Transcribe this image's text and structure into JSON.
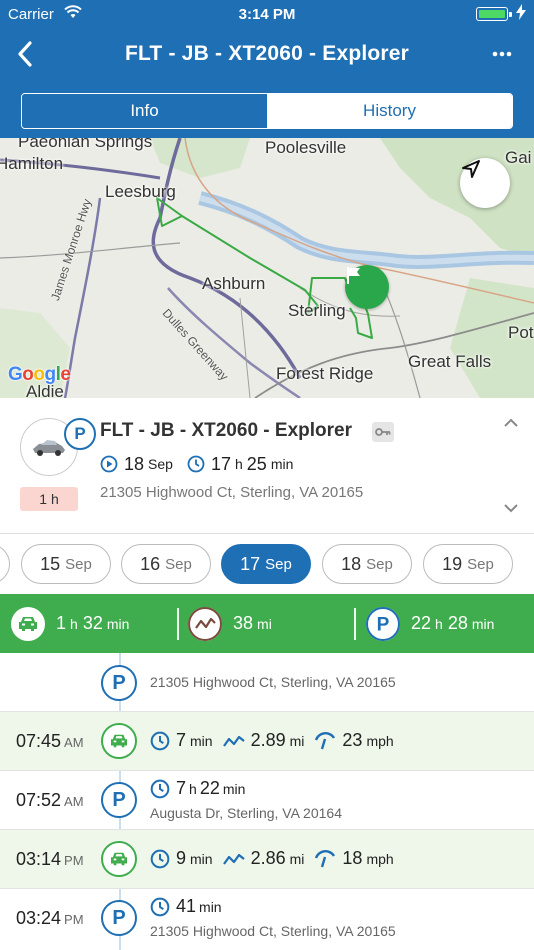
{
  "status_bar": {
    "carrier": "Carrier",
    "time": "3:14 PM"
  },
  "nav": {
    "title": "FLT - JB - XT2060 - Explorer"
  },
  "tabs": [
    {
      "label": "Info",
      "active": true
    },
    {
      "label": "History",
      "active": false
    }
  ],
  "map": {
    "places": [
      "Paeonian Springs",
      "Hamilton",
      "Poolesville",
      "Gai",
      "Leesburg",
      "Ashburn",
      "Sterling",
      "Pot",
      "Great Falls",
      "Forest Ridge",
      "Aldie"
    ],
    "roads": [
      "James Monroe Hwy",
      "Dulles Greenway"
    ],
    "attribution": "Google"
  },
  "vehicle": {
    "name": "FLT - JB - XT2060 - Explorer",
    "badge": "P",
    "duration_badge": "1 h",
    "date_day": "18",
    "date_month": "Sep",
    "drive_h": "17",
    "drive_h_unit": "h",
    "drive_m": "25",
    "drive_m_unit": "min",
    "address": "21305 Highwood Ct, Sterling, VA 20165"
  },
  "dates": [
    {
      "day": "15",
      "month": "Sep",
      "active": false
    },
    {
      "day": "16",
      "month": "Sep",
      "active": false
    },
    {
      "day": "17",
      "month": "Sep",
      "active": true
    },
    {
      "day": "18",
      "month": "Sep",
      "active": false
    },
    {
      "day": "19",
      "month": "Sep",
      "active": false
    }
  ],
  "summary": {
    "drive_h": "1",
    "drive_h_unit": "h",
    "drive_m": "32",
    "drive_m_unit": "min",
    "distance": "38",
    "distance_unit": "mi",
    "park_h": "22",
    "park_h_unit": "h",
    "park_m": "28",
    "park_m_unit": "min"
  },
  "timeline": [
    {
      "type": "park",
      "address": "21305 Highwood Ct, Sterling, VA 20165"
    },
    {
      "type": "drive",
      "time": "07:45",
      "ampm": "AM",
      "dur": "7",
      "dur_unit": "min",
      "dist": "2.89",
      "dist_unit": "mi",
      "speed": "23",
      "speed_unit": "mph"
    },
    {
      "type": "park",
      "time": "07:52",
      "ampm": "AM",
      "dur_h": "7",
      "dur_h_unit": "h",
      "dur_m": "22",
      "dur_m_unit": "min",
      "address": "Augusta Dr, Sterling, VA 20164"
    },
    {
      "type": "drive",
      "time": "03:14",
      "ampm": "PM",
      "dur": "9",
      "dur_unit": "min",
      "dist": "2.86",
      "dist_unit": "mi",
      "speed": "18",
      "speed_unit": "mph"
    },
    {
      "type": "park",
      "time": "03:24",
      "ampm": "PM",
      "dur": "41",
      "dur_unit": "min",
      "address": "21305 Highwood Ct, Sterling, VA 20165"
    }
  ],
  "colors": {
    "primary": "#1f6fb4",
    "drive_green": "#3fad4d",
    "drive_row_bg": "#eef7ea",
    "duration_badge_bg": "#fbd5d0"
  }
}
